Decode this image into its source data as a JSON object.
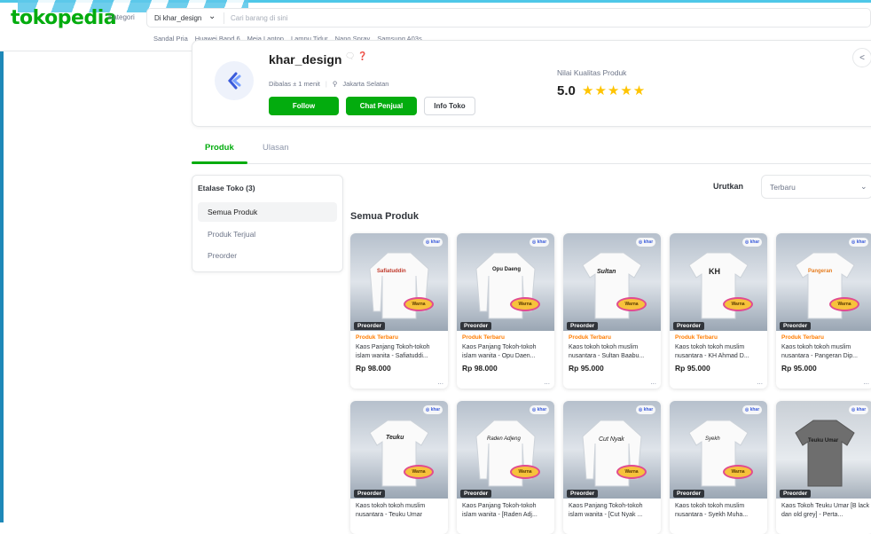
{
  "header": {
    "logo": "tokopedia",
    "kategori": "Kategori",
    "search_scope": "Di khar_design",
    "search_placeholder": "Cari barang di sini",
    "suggestions": [
      "Sandal Pria",
      "Huawei Band 6",
      "Meja Laptop",
      "Lampu Tidur",
      "Nano Spray",
      "Samsung A03s"
    ]
  },
  "shop": {
    "name": "khar_design",
    "badge_icons": [
      "gold-badge-icon",
      "help-icon"
    ],
    "response": "Dibalas ± 1 menit",
    "location": "Jakarta Selatan",
    "follow_label": "Follow",
    "chat_label": "Chat Penjual",
    "info_label": "Info Toko",
    "quality_label": "Nilai Kualitas Produk",
    "quality_score": "5.0",
    "stars": "★★★★★",
    "share_icon": "share-icon"
  },
  "tabs": [
    {
      "label": "Produk",
      "active": true
    },
    {
      "label": "Ulasan",
      "active": false
    }
  ],
  "etalase": {
    "title": "Etalase Toko (3)",
    "items": [
      {
        "label": "Semua Produk",
        "active": true
      },
      {
        "label": "Produk Terjual",
        "active": false
      },
      {
        "label": "Preorder",
        "active": false
      }
    ]
  },
  "sort": {
    "label": "Urutkan",
    "value": "Terbaru"
  },
  "section_title": "Semua Produk",
  "products": [
    {
      "badge": "Produk Terbaru",
      "name": "Kaos Panjang Tokoh-tokoh islam wanita - Safiatuddi...",
      "price": "Rp 98.000",
      "tag": "Preorder",
      "shirt_text": "Safiatuddin"
    },
    {
      "badge": "Produk Terbaru",
      "name": "Kaos Panjang Tokoh-tokoh islam wanita - Opu Daen...",
      "price": "Rp 98.000",
      "tag": "Preorder",
      "shirt_text": "Opu Daeng"
    },
    {
      "badge": "Produk Terbaru",
      "name": "Kaos tokoh tokoh muslim nusantara - Sultan Baabu...",
      "price": "Rp 95.000",
      "tag": "Preorder",
      "shirt_text": "Sultan"
    },
    {
      "badge": "Produk Terbaru",
      "name": "Kaos tokoh tokoh muslim nusantara - KH Ahmad D...",
      "price": "Rp 95.000",
      "tag": "Preorder",
      "shirt_text": "KH"
    },
    {
      "badge": "Produk Terbaru",
      "name": "Kaos tokoh tokoh muslim nusantara - Pangeran Dip...",
      "price": "Rp 95.000",
      "tag": "Preorder",
      "shirt_text": "Pangeran"
    },
    {
      "name": "Kaos tokoh tokoh muslim nusantara - Teuku Umar",
      "tag": "Preorder",
      "shirt_text": "Teuku"
    },
    {
      "name": "Kaos Panjang Tokoh-tokoh islam wanita - [Raden Adj...",
      "tag": "Preorder",
      "shirt_text": "Raden Adjeng"
    },
    {
      "name": "Kaos Panjang Tokoh-tokoh islam wanita - [Cut Nyak ...",
      "tag": "Preorder",
      "shirt_text": "Cut Nyak"
    },
    {
      "name": "Kaos tokoh tokoh muslim nusantara - Syekh Muha...",
      "tag": "Preorder",
      "shirt_text": "Syekh"
    },
    {
      "name": "Kaos Tokoh Teuku Umar [B lack dan old grey] - Perta...",
      "tag": "Preorder",
      "shirt_text": "Teuku Umar"
    }
  ],
  "colors": {
    "brand_green": "#03ac0e",
    "star": "#ffc400",
    "badge_orange": "#ff7c00"
  }
}
